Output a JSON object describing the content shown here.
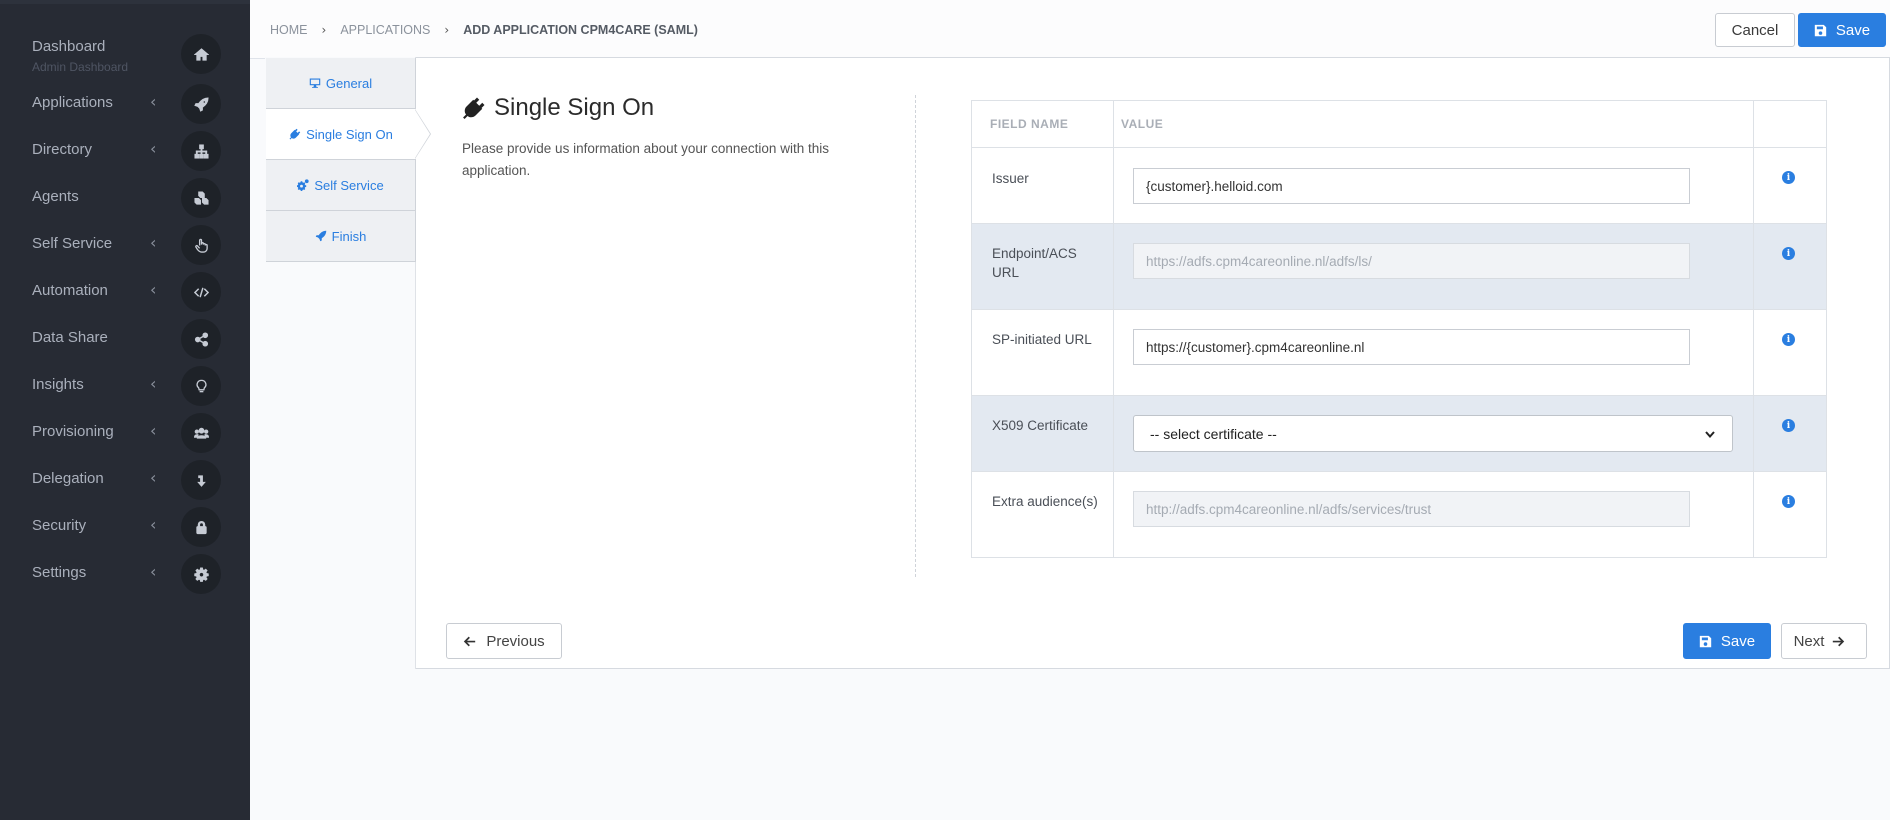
{
  "sidebar": {
    "items": [
      {
        "label": "Dashboard",
        "sub": "Admin Dashboard",
        "icon": "home-icon",
        "chevron": false
      },
      {
        "label": "Applications",
        "icon": "rocket-icon",
        "chevron": true
      },
      {
        "label": "Directory",
        "icon": "sitemap-icon",
        "chevron": true
      },
      {
        "label": "Agents",
        "icon": "cubes-icon",
        "chevron": false
      },
      {
        "label": "Self Service",
        "icon": "hand-pointer-icon",
        "chevron": true
      },
      {
        "label": "Automation",
        "icon": "code-icon",
        "chevron": true
      },
      {
        "label": "Data Share",
        "icon": "share-icon",
        "chevron": false
      },
      {
        "label": "Insights",
        "icon": "lightbulb-icon",
        "chevron": true
      },
      {
        "label": "Provisioning",
        "icon": "users-icon",
        "chevron": true
      },
      {
        "label": "Delegation",
        "icon": "level-down-icon",
        "chevron": true
      },
      {
        "label": "Security",
        "icon": "lock-icon",
        "chevron": true
      },
      {
        "label": "Settings",
        "icon": "gear-icon",
        "chevron": true
      }
    ],
    "chevron_glyph": "‹"
  },
  "breadcrumb": {
    "home": "HOME",
    "applications": "APPLICATIONS",
    "current": "ADD APPLICATION CPM4CARE (SAML)",
    "separator": "›"
  },
  "toolbar": {
    "cancel_label": "Cancel",
    "save_label": "Save"
  },
  "tabs": [
    {
      "label": "General",
      "icon": "desktop-icon"
    },
    {
      "label": "Single Sign On",
      "icon": "plug-icon"
    },
    {
      "label": "Self Service",
      "icon": "cogs-icon"
    },
    {
      "label": "Finish",
      "icon": "rocket-icon"
    }
  ],
  "step": {
    "title": "Single Sign On",
    "description": "Please provide us information about your connection with this application."
  },
  "fields": {
    "header_name": "FIELD NAME",
    "header_value": "VALUE",
    "rows": [
      {
        "name": "Issuer",
        "value": "{customer}.helloid.com",
        "type": "text"
      },
      {
        "name": "Endpoint/ACS URL",
        "placeholder": "https://adfs.cpm4careonline.nl/adfs/ls/",
        "type": "disabled"
      },
      {
        "name": "SP-initiated URL",
        "value": "https://{customer}.cpm4careonline.nl",
        "type": "text"
      },
      {
        "name": "X509 Certificate",
        "value": "-- select certificate --",
        "type": "select"
      },
      {
        "name": "Extra audience(s)",
        "placeholder": "http://adfs.cpm4careonline.nl/adfs/services/trust",
        "type": "disabled"
      }
    ],
    "info_glyph": "i"
  },
  "footer": {
    "previous_label": "Previous",
    "save_label": "Save",
    "next_label": "Next"
  },
  "colors": {
    "accent": "#2a7ee0",
    "sidebar_bg": "#272b34",
    "row_shade": "#e3e9f1"
  }
}
